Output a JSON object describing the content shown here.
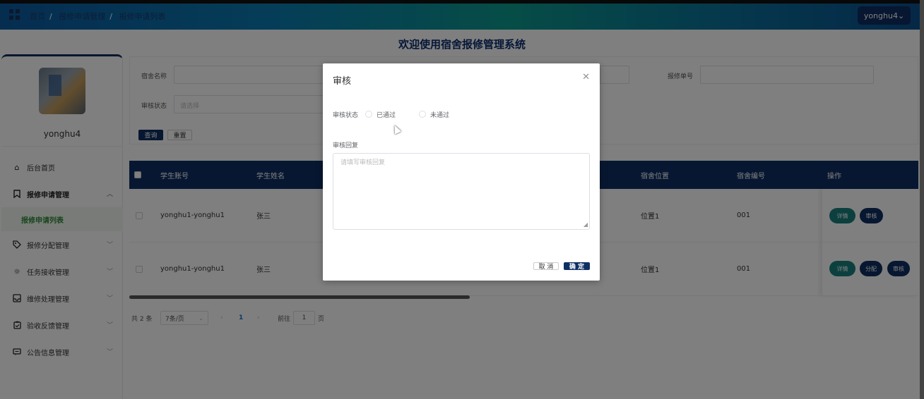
{
  "header": {
    "breadcrumbs": [
      "首页",
      "报修申请管理",
      "报修申请列表"
    ],
    "user_menu": "yonghu4⌄"
  },
  "page_title": "欢迎使用宿舍报修管理系统",
  "sidebar": {
    "username": "yonghu4",
    "menu": [
      {
        "label": "后台首页",
        "icon": "home-icon"
      },
      {
        "label": "报修申请管理",
        "icon": "bookmark-icon",
        "open": true,
        "submenu": [
          "报修申请列表"
        ]
      },
      {
        "label": "报修分配管理",
        "icon": "tag-icon"
      },
      {
        "label": "任务接收管理",
        "icon": "sun-icon"
      },
      {
        "label": "维修处理管理",
        "icon": "inbox-icon"
      },
      {
        "label": "验收反馈管理",
        "icon": "clipboard-icon"
      },
      {
        "label": "公告信息管理",
        "icon": "message-icon"
      }
    ]
  },
  "search": {
    "dorm_name_label": "宿舍名称",
    "repair_no_label": "报修单号",
    "review_status_label": "审核状态",
    "review_status_placeholder": "请选择",
    "query_label": "查询",
    "reset_label": "重置"
  },
  "table": {
    "columns": [
      "学生账号",
      "学生姓名",
      "宿舍位置",
      "宿舍编号",
      "操作"
    ],
    "rows": [
      {
        "account": "yonghu1-yonghu1",
        "name": "张三",
        "location": "位置1",
        "dorm_no": "001",
        "actions": [
          "详情",
          "审核"
        ]
      },
      {
        "account": "yonghu1-yonghu1",
        "name": "张三",
        "location": "位置1",
        "dorm_no": "001",
        "actions": [
          "详情",
          "分配",
          "审核"
        ]
      }
    ]
  },
  "pagination": {
    "total": "共 2 条",
    "page_size": "7条/页",
    "current_page": "1",
    "goto_prefix": "前往",
    "goto_value": "1",
    "goto_suffix": "页"
  },
  "modal": {
    "title": "审核",
    "status_label": "审核状态",
    "options": [
      "已通过",
      "未通过"
    ],
    "reply_label": "审核回复",
    "reply_placeholder": "请填写审核回复",
    "cancel_label": "取 消",
    "ok_label": "确 定"
  },
  "colors": {
    "primary": "#0e2f63",
    "detail_button": "#18807e",
    "submenu_active": "#2f8a3a"
  }
}
